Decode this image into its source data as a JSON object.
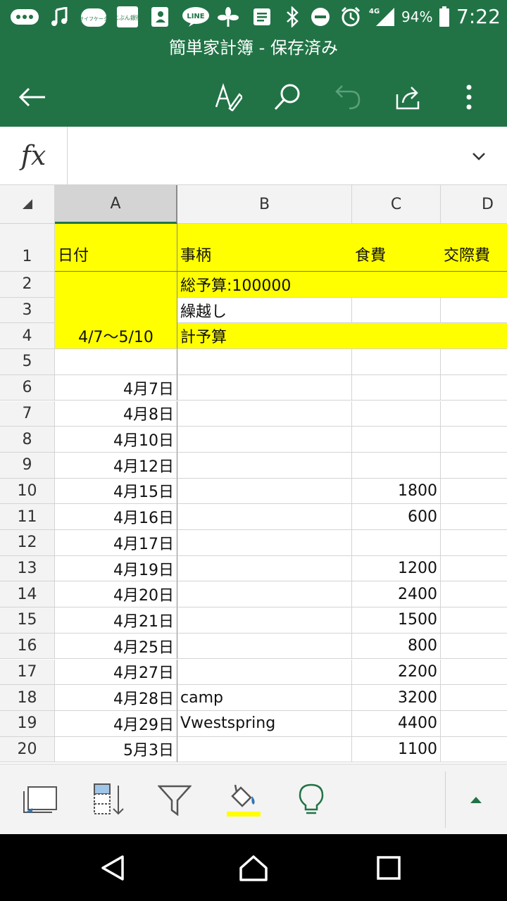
{
  "status_bar": {
    "battery_percent": "94%",
    "network": "4G",
    "time": "7:22",
    "icons": [
      "message-icon",
      "music-note-icon",
      "app-icon",
      "bank-icon",
      "contacts-icon",
      "line-icon",
      "flower-icon",
      "notes-icon",
      "bluetooth-icon",
      "do-not-disturb-icon",
      "alarm-icon",
      "signal-icon",
      "battery-icon"
    ],
    "app_label_1": "おサイフケータイ",
    "app_label_2": "じぶん銀行",
    "line_label": "LINE"
  },
  "app_bar": {
    "title": "簡単家計簿 - 保存済み",
    "color": "#217346",
    "icons": [
      "back-arrow-icon",
      "edit-icon",
      "search-icon",
      "undo-icon",
      "share-icon",
      "more-icon"
    ]
  },
  "formula_bar": {
    "fx_label": "fx",
    "value": ""
  },
  "grid": {
    "columns": [
      "A",
      "B",
      "C",
      "D"
    ],
    "rows": [
      {
        "n": "1",
        "a": "日付",
        "b": "事柄",
        "c": "食費",
        "d": "交際費"
      },
      {
        "n": "2",
        "a": "",
        "b": "総予算:100000",
        "c": "",
        "d": ""
      },
      {
        "n": "3",
        "a": "",
        "b": "繰越し",
        "c": "",
        "d": ""
      },
      {
        "n": "4",
        "a": "4/7～5/10",
        "b": "計予算",
        "c": "",
        "d": ""
      },
      {
        "n": "5",
        "a": "",
        "b": "",
        "c": "",
        "d": ""
      },
      {
        "n": "6",
        "a": "4月7日",
        "b": "",
        "c": "",
        "d": ""
      },
      {
        "n": "7",
        "a": "4月8日",
        "b": "",
        "c": "",
        "d": ""
      },
      {
        "n": "8",
        "a": "4月10日",
        "b": "",
        "c": "",
        "d": ""
      },
      {
        "n": "9",
        "a": "4月12日",
        "b": "",
        "c": "",
        "d": ""
      },
      {
        "n": "10",
        "a": "4月15日",
        "b": "",
        "c": "1800",
        "d": ""
      },
      {
        "n": "11",
        "a": "4月16日",
        "b": "",
        "c": "600",
        "d": ""
      },
      {
        "n": "12",
        "a": "4月17日",
        "b": "",
        "c": "",
        "d": ""
      },
      {
        "n": "13",
        "a": "4月19日",
        "b": "",
        "c": "1200",
        "d": ""
      },
      {
        "n": "14",
        "a": "4月20日",
        "b": "",
        "c": "2400",
        "d": ""
      },
      {
        "n": "15",
        "a": "4月21日",
        "b": "",
        "c": "1500",
        "d": ""
      },
      {
        "n": "16",
        "a": "4月25日",
        "b": "",
        "c": "800",
        "d": ""
      },
      {
        "n": "17",
        "a": "4月27日",
        "b": "",
        "c": "2200",
        "d": ""
      },
      {
        "n": "18",
        "a": "4月28日",
        "b": "camp",
        "c": "3200",
        "d": ""
      },
      {
        "n": "19",
        "a": "4月29日",
        "b": "Vwestspring",
        "c": "4400",
        "d": ""
      },
      {
        "n": "20",
        "a": "5月3日",
        "b": "",
        "c": "1100",
        "d": ""
      }
    ],
    "highlight_color": "#ffff00"
  },
  "toolbar": {
    "icons": [
      "freeze-panes-icon",
      "sort-icon",
      "filter-icon",
      "fill-color-icon",
      "lightbulb-icon",
      "expand-up-icon"
    ],
    "fill_color": "#ffff00"
  },
  "nav_bar": {
    "icons": [
      "back-triangle-icon",
      "home-icon",
      "recents-icon"
    ]
  }
}
